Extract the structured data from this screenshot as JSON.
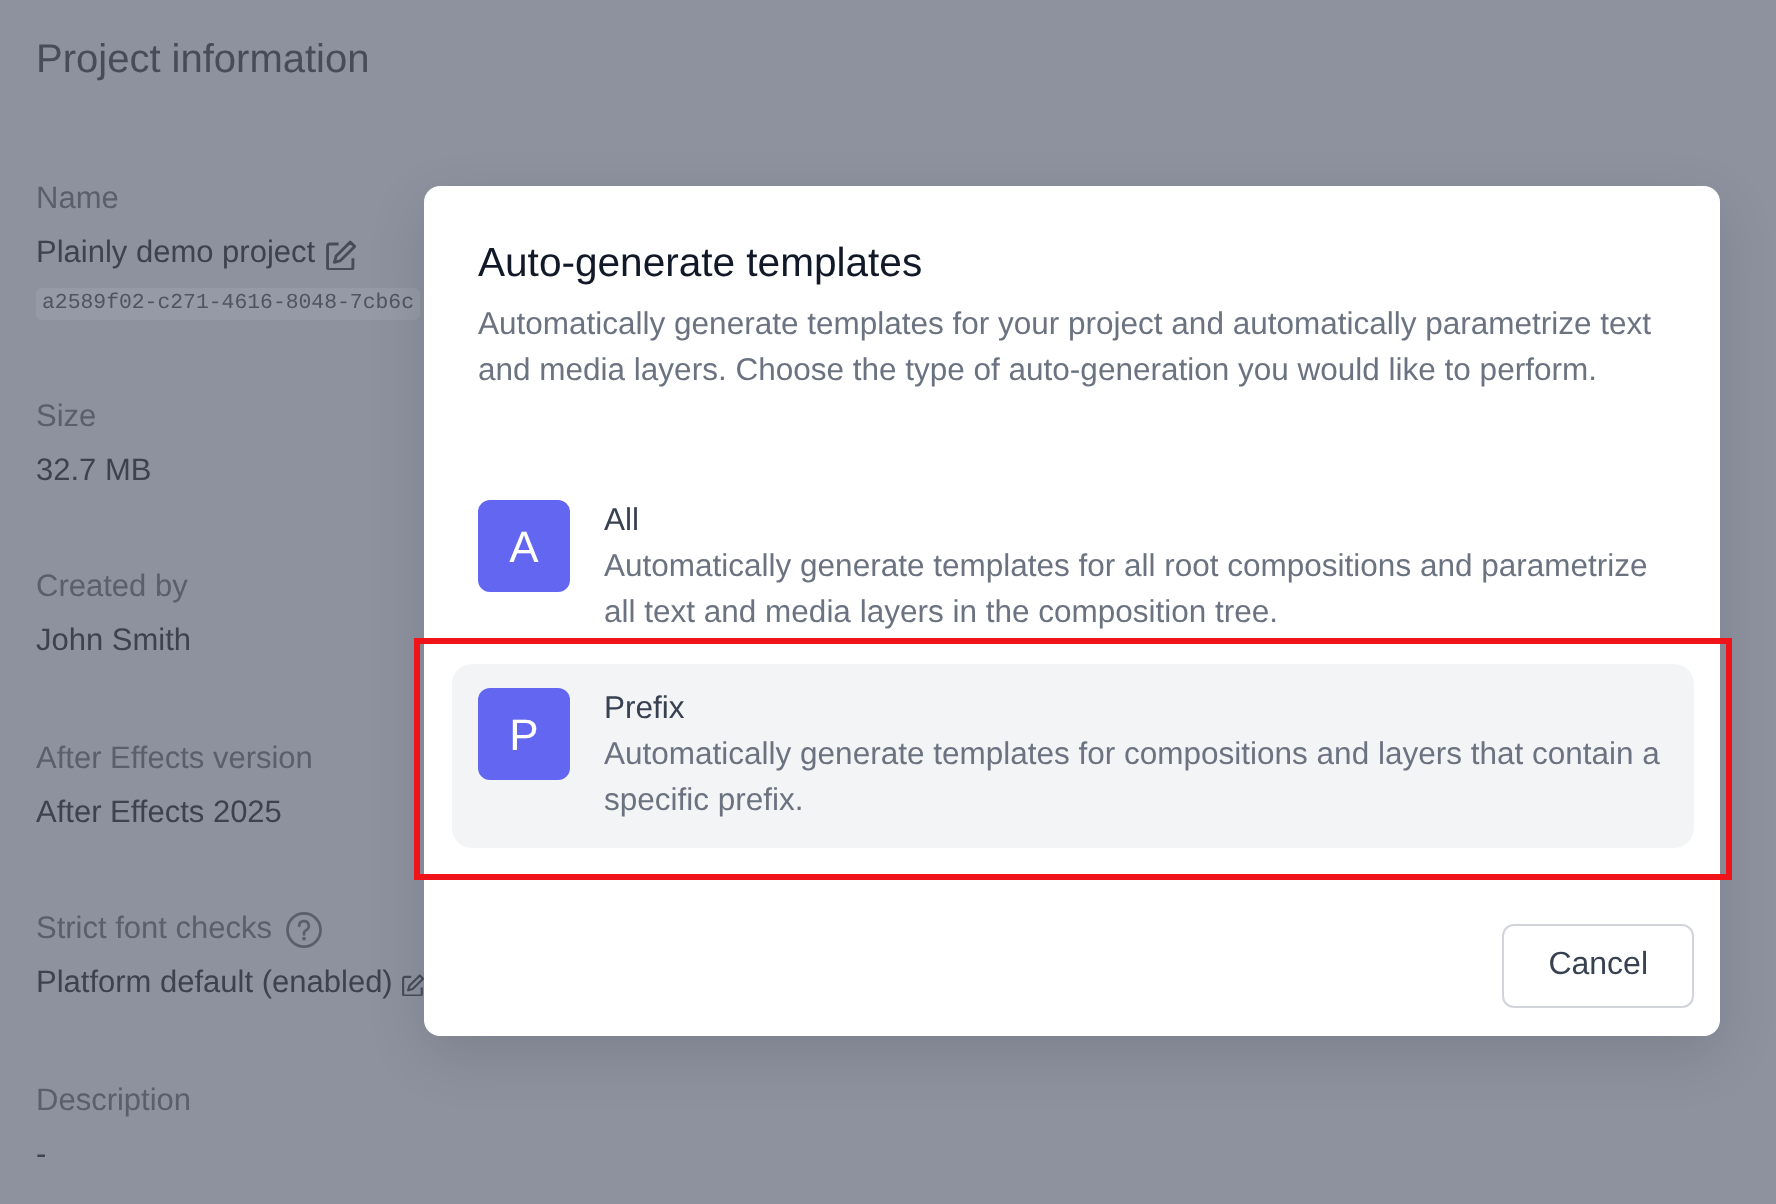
{
  "page": {
    "title": "Project information",
    "fields": [
      {
        "label": "Name",
        "value": "Plainly demo project",
        "editable": true,
        "help": false,
        "identifier": "a2589f02-c271-4616-8048-7cb6c"
      },
      {
        "label": "Size",
        "value": "32.7 MB",
        "editable": false,
        "help": false
      },
      {
        "label": "Created by",
        "value": "John Smith",
        "editable": false,
        "help": false
      },
      {
        "label": "After Effects version",
        "value": "After Effects 2025",
        "editable": false,
        "help": false
      },
      {
        "label": "Strict font checks",
        "value": "Platform default (enabled)",
        "editable": true,
        "help": true
      },
      {
        "label": "Description",
        "value": "-",
        "editable": false,
        "help": false
      }
    ]
  },
  "dialog": {
    "title": "Auto-generate templates",
    "description": "Automatically generate templates for your project and automatically parametrize text and media layers. Choose the type of auto-generation you would like to perform.",
    "options": [
      {
        "letter": "A",
        "title": "All",
        "description": "Automatically generate templates for all root compositions and parametrize all text and media layers in the composition tree.",
        "selected": false,
        "highlighted": false
      },
      {
        "letter": "P",
        "title": "Prefix",
        "description": "Automatically generate templates for compositions and layers that contain a specific prefix.",
        "selected": true,
        "highlighted": true
      }
    ],
    "buttons": [
      {
        "label": "Cancel",
        "kind": "cancel"
      }
    ]
  }
}
